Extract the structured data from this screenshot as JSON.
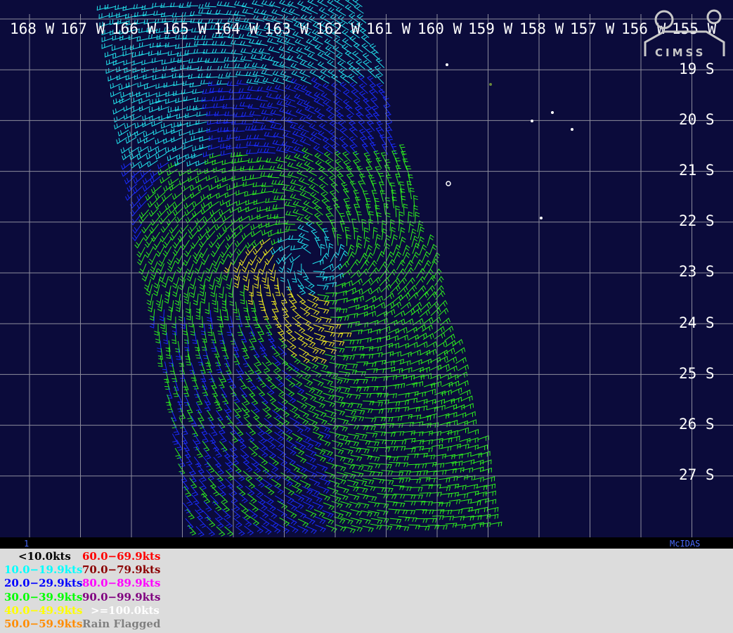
{
  "map": {
    "lon_labels": [
      "168 W",
      "167 W",
      "166 W",
      "165 W",
      "164 W",
      "163 W",
      "162 W",
      "161 W",
      "160 W",
      "159 W",
      "158 W",
      "157 W",
      "156 W",
      "155 W"
    ],
    "lat_labels": [
      "19 S",
      "20 S",
      "21 S",
      "22 S",
      "23 S",
      "24 S",
      "25 S",
      "26 S",
      "27 S"
    ],
    "footer_left": "1",
    "footer_right": "McIDAS",
    "logo_text": "CIMSS",
    "colors": {
      "background": "#0b0b3b",
      "grid": "#8c8c9c",
      "land": "#ffffff"
    }
  },
  "legend": {
    "items": [
      {
        "label": "<10.0kts",
        "color": "#000000"
      },
      {
        "label": "10.0−19.9kts",
        "color": "#00ffff"
      },
      {
        "label": "20.0−29.9kts",
        "color": "#0000ff"
      },
      {
        "label": "30.0−39.9kts",
        "color": "#00ff00"
      },
      {
        "label": "40.0−49.9kts",
        "color": "#ffff00"
      },
      {
        "label": "50.0−59.9kts",
        "color": "#ff8c00"
      },
      {
        "label": "60.0−69.9kts",
        "color": "#ff0000"
      },
      {
        "label": "70.0−79.9kts",
        "color": "#8b0000"
      },
      {
        "label": "80.0−89.9kts",
        "color": "#ff00ff"
      },
      {
        "label": "90.0−99.9kts",
        "color": "#800080"
      },
      {
        "label": ">=100.0kts",
        "color": "#ffffff"
      },
      {
        "label": "Rain Flagged",
        "color": "#808080"
      }
    ]
  }
}
